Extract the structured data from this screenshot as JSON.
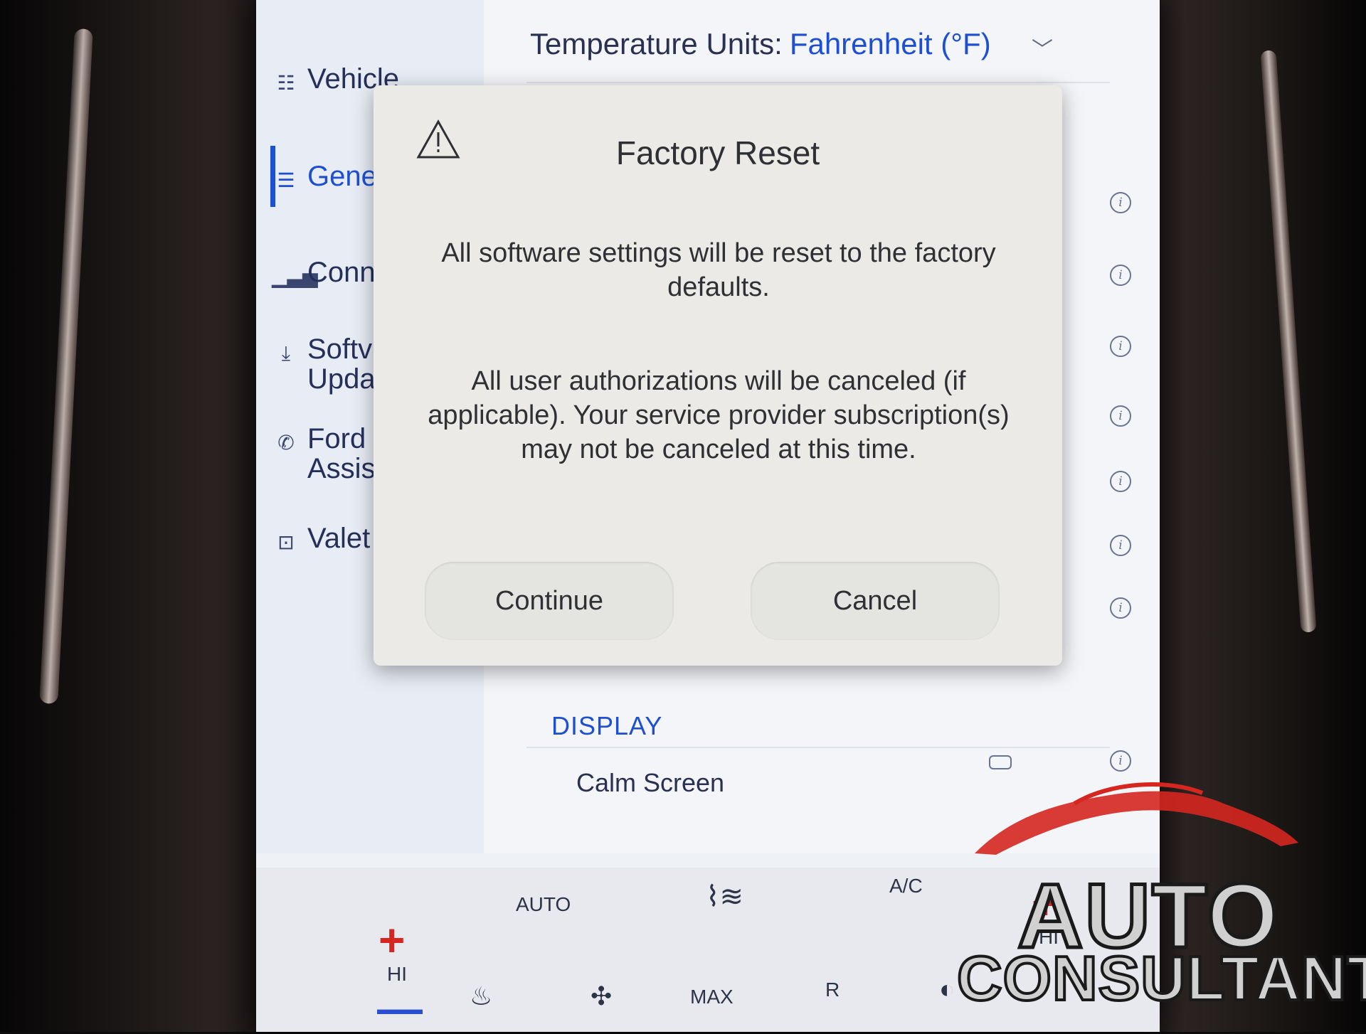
{
  "sidebar": {
    "items": [
      {
        "label": "Vehicle",
        "icon": "vehicle-settings-icon"
      },
      {
        "label": "Gene",
        "icon": "sliders-icon",
        "active": true
      },
      {
        "label": "Conn",
        "icon": "signal-bars-icon"
      },
      {
        "label": "Softv\nUpda",
        "icon": "download-icon"
      },
      {
        "label": "Ford\nAssis",
        "icon": "assist-icon"
      },
      {
        "label": "Valet",
        "icon": "valet-icon"
      }
    ]
  },
  "settings": {
    "temperature_label": "Temperature Units:",
    "temperature_value": "Fahrenheit (°F)",
    "display_header": "DISPLAY",
    "calm_screen_label": "Calm Screen"
  },
  "dialog": {
    "title": "Factory Reset",
    "message1": "All software settings will be reset to the factory defaults.",
    "message2": "All user authorizations will be canceled (if applicable). Your service provider subscription(s) may not be canceled at this time.",
    "continue_label": "Continue",
    "cancel_label": "Cancel"
  },
  "climate": {
    "hi_left": "HI",
    "auto": "AUTO",
    "ac": "A/C",
    "max_defrost": "MAX",
    "rear_defrost": "R",
    "hi_right": "HI",
    "plus": "+",
    "minus": "—"
  },
  "watermark": {
    "line1": "AUTO",
    "line2": "CONSULTANT"
  },
  "colors": {
    "accent": "#1f4fd1",
    "temp_up": "#d5271f",
    "temp_down": "#2a4fd0",
    "watermark_car": "#d5271f"
  }
}
